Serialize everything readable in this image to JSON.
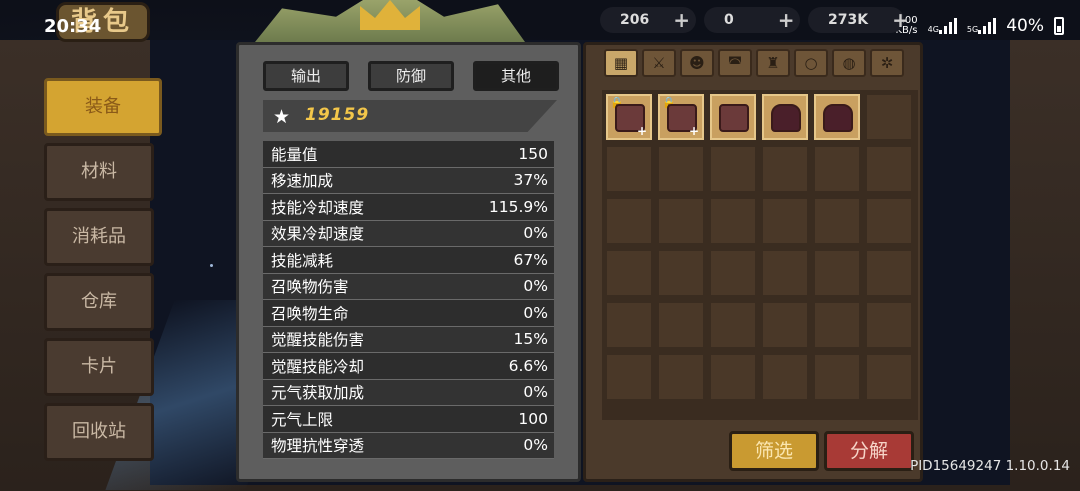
{
  "status_bar": {
    "time": "20:34",
    "net_speed": "0.00",
    "net_unit": "KB/s",
    "net_4g": "4G",
    "net_5g": "5G",
    "battery": "40%"
  },
  "header": {
    "title": "背包"
  },
  "currencies": [
    {
      "name": "materials",
      "value": "206",
      "color": "#c9852e"
    },
    {
      "name": "gems",
      "value": "0",
      "color": "#4a8fcf"
    },
    {
      "name": "coins",
      "value": "273K",
      "color": "#d9b02f"
    }
  ],
  "sidebar": {
    "items": [
      {
        "label": "装备",
        "active": true
      },
      {
        "label": "材料"
      },
      {
        "label": "消耗品"
      },
      {
        "label": "仓库"
      },
      {
        "label": "卡片"
      },
      {
        "label": "回收站"
      }
    ]
  },
  "stats": {
    "tabs": [
      "输出",
      "防御",
      "其他"
    ],
    "active_tab": "其他",
    "power": "19159",
    "rows": [
      {
        "label": "能量值",
        "value": "150"
      },
      {
        "label": "移速加成",
        "value": "37%"
      },
      {
        "label": "技能冷却速度",
        "value": "115.9%"
      },
      {
        "label": "效果冷却速度",
        "value": "0%"
      },
      {
        "label": "技能减耗",
        "value": "67%"
      },
      {
        "label": "召唤物伤害",
        "value": "0%"
      },
      {
        "label": "召唤物生命",
        "value": "0%"
      },
      {
        "label": "觉醒技能伤害",
        "value": "15%"
      },
      {
        "label": "觉醒技能冷却",
        "value": "6.6%"
      },
      {
        "label": "元气获取加成",
        "value": "0%"
      },
      {
        "label": "元气上限",
        "value": "100"
      },
      {
        "label": "物理抗性穿透",
        "value": "0%"
      }
    ]
  },
  "inventory": {
    "categories": [
      "grid-icon",
      "sword-icon",
      "mask-icon",
      "helmet-icon",
      "armor-icon",
      "ring-icon",
      "bag-icon",
      "gear-icon"
    ],
    "filter_label": "筛选",
    "decompose_label": "分解"
  },
  "footer": {
    "pid": "PID15649247 1.10.0.14"
  }
}
